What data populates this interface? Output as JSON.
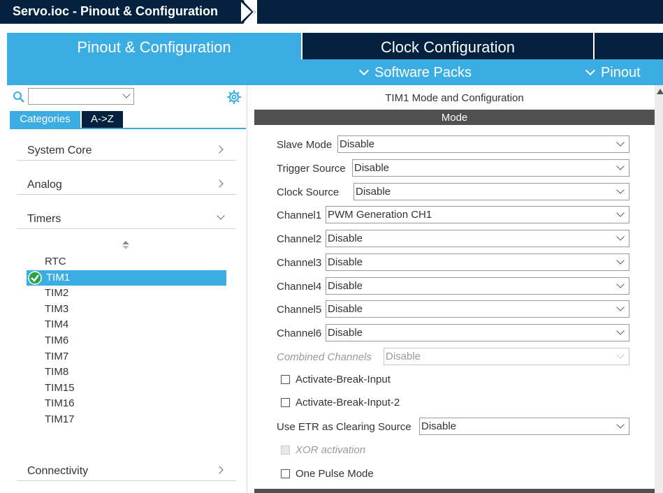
{
  "window": {
    "title": "Servo.ioc - Pinout & Configuration"
  },
  "tabs": [
    {
      "label": "Pinout & Configuration",
      "active": true
    },
    {
      "label": "Clock Configuration",
      "active": false
    }
  ],
  "subbar": {
    "software_packs": "Software Packs",
    "pinout": "Pinout"
  },
  "sidebar": {
    "search": {
      "value": "",
      "placeholder": ""
    },
    "view_tabs": [
      {
        "label": "Categories",
        "active": true
      },
      {
        "label": "A->Z",
        "active": false
      }
    ],
    "categories": [
      {
        "label": "System Core",
        "expanded": false
      },
      {
        "label": "Analog",
        "expanded": false
      },
      {
        "label": "Timers",
        "expanded": true
      },
      {
        "label": "Connectivity",
        "expanded": false
      }
    ],
    "timers": [
      "RTC",
      "TIM1",
      "TIM2",
      "TIM3",
      "TIM4",
      "TIM6",
      "TIM7",
      "TIM8",
      "TIM15",
      "TIM16",
      "TIM17"
    ],
    "selected_timer": "TIM1"
  },
  "main": {
    "title": "TIM1 Mode and Configuration",
    "section": "Mode",
    "fields": [
      {
        "label": "Slave Mode",
        "value": "Disable"
      },
      {
        "label": "Trigger Source",
        "value": "Disable"
      },
      {
        "label": "Clock Source",
        "value": "Disable"
      },
      {
        "label": "Channel1",
        "value": "PWM Generation CH1"
      },
      {
        "label": "Channel2",
        "value": "Disable"
      },
      {
        "label": "Channel3",
        "value": "Disable"
      },
      {
        "label": "Channel4",
        "value": "Disable"
      },
      {
        "label": "Channel5",
        "value": "Disable"
      },
      {
        "label": "Channel6",
        "value": "Disable"
      },
      {
        "label": "Combined Channels",
        "value": "Disable",
        "disabled": true
      }
    ],
    "checkboxes": [
      {
        "label": "Activate-Break-Input",
        "checked": false,
        "disabled": false
      },
      {
        "label": "Activate-Break-Input-2",
        "checked": false,
        "disabled": false
      }
    ],
    "etr": {
      "label": "Use ETR as Clearing Source",
      "value": "Disable"
    },
    "checkboxes_2": [
      {
        "label": "XOR activation",
        "checked": false,
        "disabled": true
      },
      {
        "label": "One Pulse Mode",
        "checked": false,
        "disabled": false
      }
    ]
  },
  "colors": {
    "navy": "#04213f",
    "accent": "#3bade3",
    "mode_bar": "#505050",
    "check_green": "#2aa44a"
  }
}
